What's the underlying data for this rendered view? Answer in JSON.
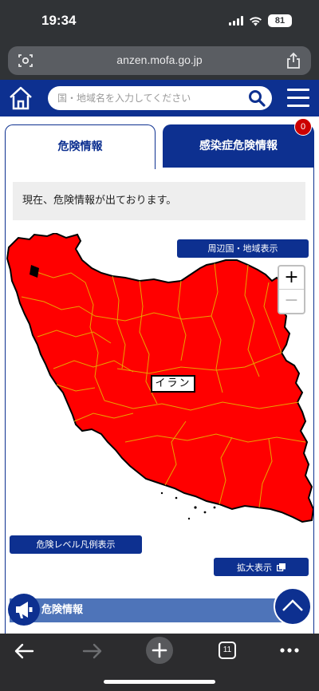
{
  "status_bar": {
    "time": "19:34",
    "battery": "81"
  },
  "browser": {
    "url": "anzen.mofa.go.jp",
    "open_tabs": "11"
  },
  "header": {
    "search_placeholder": "国・地域名を入力してください"
  },
  "tabs": [
    {
      "label": "危険情報",
      "active": true
    },
    {
      "label": "感染症危険情報",
      "badge": "0",
      "active": false
    }
  ],
  "notice": "現在、危険情報が出ております。",
  "map": {
    "country_label": "イラン",
    "fill_color": "#ff0000",
    "border_color": "#e8a300",
    "neighbors_button": "周辺国・地域表示",
    "zoom_in": "+",
    "zoom_out": "−",
    "legend_button": "危険レベル凡例表示",
    "enlarge_button": "拡大表示"
  },
  "info_section": {
    "label": "危険情報"
  },
  "colors": {
    "brand": "#0d3090",
    "danger": "#ff0000",
    "info_bar": "#4e74b9"
  }
}
